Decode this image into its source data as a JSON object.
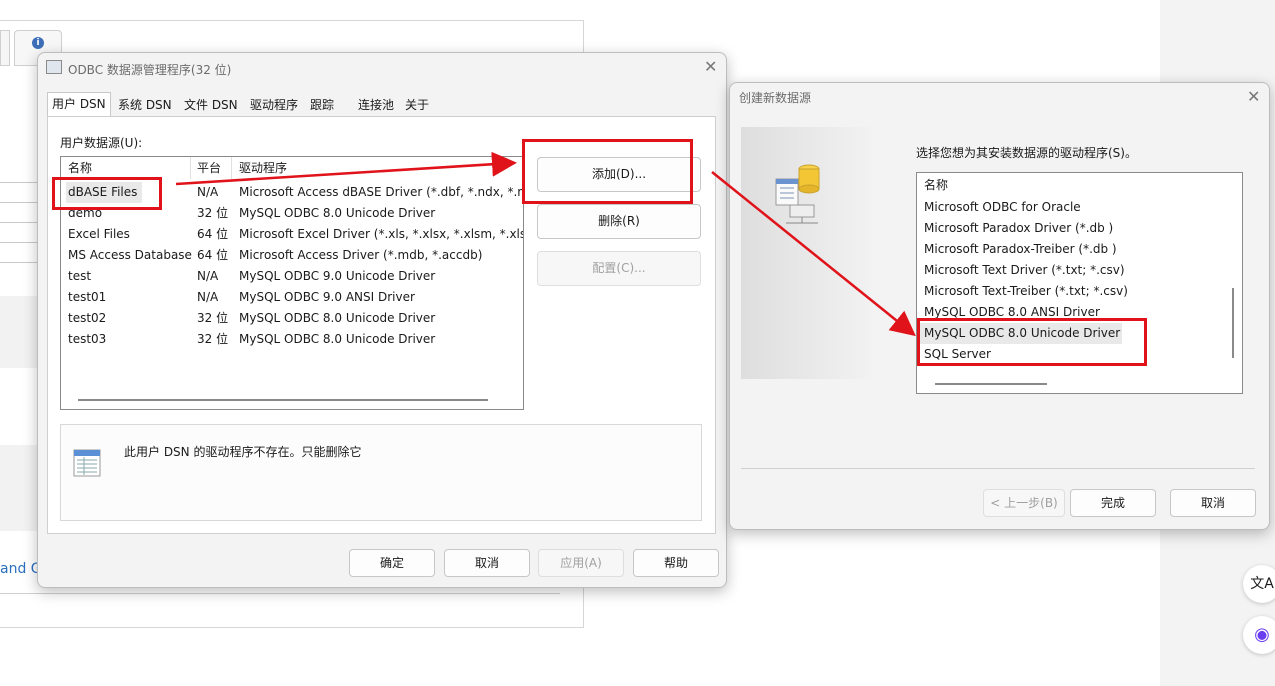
{
  "background": {
    "link_text": "and G"
  },
  "odbc": {
    "title": "ODBC 数据源管理程序(32 位)",
    "tabs": [
      "用户 DSN",
      "系统 DSN",
      "文件 DSN",
      "驱动程序",
      "跟踪",
      "连接池",
      "关于"
    ],
    "list_label": "用户数据源(U):",
    "columns": [
      "名称",
      "平台",
      "驱动程序"
    ],
    "rows": [
      {
        "name": "dBASE Files",
        "platform": "N/A",
        "driver": "Microsoft Access dBASE Driver (*.dbf, *.ndx, *.mdx)"
      },
      {
        "name": "demo",
        "platform": "32 位",
        "driver": "MySQL ODBC 8.0 Unicode Driver"
      },
      {
        "name": "Excel Files",
        "platform": "64 位",
        "driver": "Microsoft Excel Driver (*.xls, *.xlsx, *.xlsm, *.xlsb)"
      },
      {
        "name": "MS Access Database",
        "platform": "64 位",
        "driver": "Microsoft Access Driver (*.mdb, *.accdb)"
      },
      {
        "name": "test",
        "platform": "N/A",
        "driver": "MySQL ODBC 9.0 Unicode Driver"
      },
      {
        "name": "test01",
        "platform": "N/A",
        "driver": "MySQL ODBC 9.0 ANSI Driver"
      },
      {
        "name": "test02",
        "platform": "32 位",
        "driver": "MySQL ODBC 8.0 Unicode Driver"
      },
      {
        "name": "test03",
        "platform": "32 位",
        "driver": "MySQL ODBC 8.0 Unicode Driver"
      }
    ],
    "add_button": "添加(D)...",
    "remove_button": "删除(R)",
    "configure_button": "配置(C)...",
    "info_text": "此用户 DSN 的驱动程序不存在。只能删除它",
    "ok_button": "确定",
    "cancel_button": "取消",
    "apply_button": "应用(A)",
    "help_button": "帮助"
  },
  "create": {
    "title": "创建新数据源",
    "prompt": "选择您想为其安装数据源的驱动程序(S)。",
    "column": "名称",
    "drivers": [
      "Microsoft ODBC for Oracle",
      "Microsoft Paradox Driver (*.db )",
      "Microsoft Paradox-Treiber (*.db )",
      "Microsoft Text Driver (*.txt; *.csv)",
      "Microsoft Text-Treiber (*.txt; *.csv)",
      "MySQL ODBC 8.0 ANSI Driver",
      "MySQL ODBC 8.0 Unicode Driver",
      "SQL Server"
    ],
    "selected_driver": "MySQL ODBC 8.0 Unicode Driver",
    "back_button": "< 上一步(B)",
    "finish_button": "完成",
    "cancel_button": "取消"
  },
  "icons": {
    "info": "i",
    "translate": "文A",
    "assistant": "◉"
  },
  "colors": {
    "annotation_red": "#e0121a",
    "dialog_bg": "#f3f3f3",
    "link_blue": "#2a6ebd"
  }
}
